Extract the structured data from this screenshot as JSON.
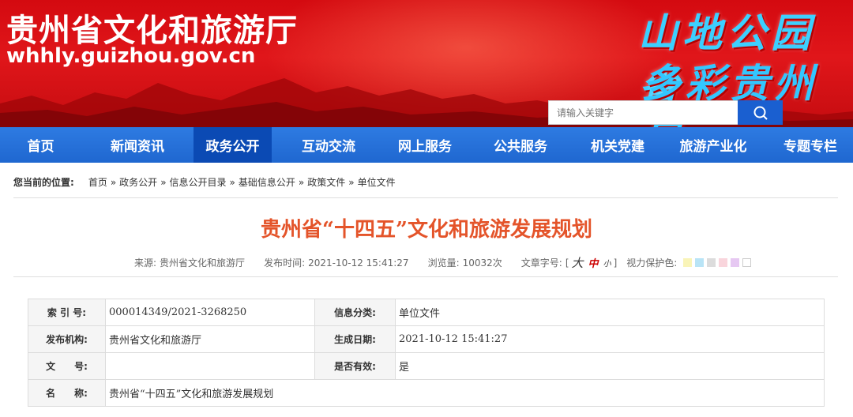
{
  "header": {
    "site_name": "贵州省文化和旅游厅",
    "site_url": "whhly.guizhou.gov.cn",
    "slogan_line1": "山地公园省",
    "slogan_line2": "多彩贵州风",
    "search_placeholder": "请输入关键字",
    "colors": {
      "banner_red": "#d40a10",
      "nav_blue": "#1f67d0",
      "nav_active": "#0b4ab4"
    }
  },
  "nav": {
    "items": [
      {
        "label": "首页"
      },
      {
        "label": "新闻资讯"
      },
      {
        "label": "政务公开"
      },
      {
        "label": "互动交流"
      },
      {
        "label": "网上服务"
      },
      {
        "label": "公共服务"
      },
      {
        "label": "机关党建"
      },
      {
        "label": "旅游产业化"
      },
      {
        "label": "专题专栏"
      }
    ],
    "active_index": 2
  },
  "breadcrumb": {
    "lead": "您当前的位置:",
    "items": [
      "首页",
      "政务公开",
      "信息公开目录",
      "基础信息公开",
      "政策文件",
      "单位文件"
    ],
    "separator": "»"
  },
  "article": {
    "title": "贵州省“十四五”文化和旅游发展规划",
    "source_label": "来源:",
    "source": "贵州省文化和旅游厅",
    "time_label": "发布时间:",
    "time": "2021-10-12 15:41:27",
    "views_label": "浏览量:",
    "views": "10032次",
    "fontsize_label": "文章字号:",
    "fontsize_open": "[",
    "fontsize_big": "大",
    "fontsize_mid": "中",
    "fontsize_small": "小",
    "fontsize_close": "]",
    "eye_label": "视力保护色:",
    "eye_colors": [
      "#f9f4b8",
      "#b9e4f6",
      "#dcdcdc",
      "#f9d5dc",
      "#e6c8f2",
      "#ffffff"
    ]
  },
  "info_table": {
    "rows": [
      {
        "k1": "索 引 号:",
        "v1": "000014349/2021-3268250",
        "k2": "信息分类:",
        "v2": "单位文件"
      },
      {
        "k1": "发布机构:",
        "v1": "贵州省文化和旅游厅",
        "k2": "生成日期:",
        "v2": "2021-10-12 15:41:27"
      },
      {
        "k1": "文　　号:",
        "v1": "",
        "k2": "是否有效:",
        "v2": "是"
      }
    ],
    "name_row": {
      "k": "名　　称:",
      "v": "贵州省“十四五”文化和旅游发展规划"
    }
  }
}
